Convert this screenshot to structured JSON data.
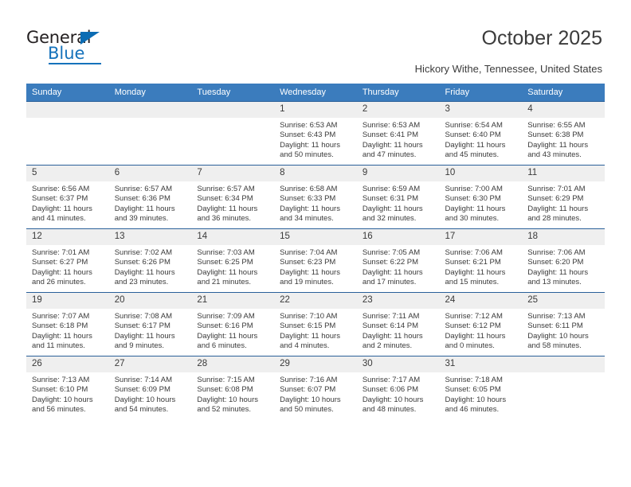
{
  "brand": {
    "name_top": "General",
    "name_bottom": "Blue",
    "accent_color": "#1572bb"
  },
  "header": {
    "title": "October 2025",
    "subtitle": "Hickory Withe, Tennessee, United States"
  },
  "calendar": {
    "header_bg": "#3b7cbd",
    "weekday_headers": [
      "Sunday",
      "Monday",
      "Tuesday",
      "Wednesday",
      "Thursday",
      "Friday",
      "Saturday"
    ],
    "labels": {
      "sunrise": "Sunrise:",
      "sunset": "Sunset:",
      "daylight": "Daylight:"
    },
    "weeks": [
      [
        {
          "day": "",
          "empty": true
        },
        {
          "day": "",
          "empty": true
        },
        {
          "day": "",
          "empty": true
        },
        {
          "day": "1",
          "sunrise": "Sunrise: 6:53 AM",
          "sunset": "Sunset: 6:43 PM",
          "daylight": "Daylight: 11 hours and 50 minutes."
        },
        {
          "day": "2",
          "sunrise": "Sunrise: 6:53 AM",
          "sunset": "Sunset: 6:41 PM",
          "daylight": "Daylight: 11 hours and 47 minutes."
        },
        {
          "day": "3",
          "sunrise": "Sunrise: 6:54 AM",
          "sunset": "Sunset: 6:40 PM",
          "daylight": "Daylight: 11 hours and 45 minutes."
        },
        {
          "day": "4",
          "sunrise": "Sunrise: 6:55 AM",
          "sunset": "Sunset: 6:38 PM",
          "daylight": "Daylight: 11 hours and 43 minutes."
        }
      ],
      [
        {
          "day": "5",
          "sunrise": "Sunrise: 6:56 AM",
          "sunset": "Sunset: 6:37 PM",
          "daylight": "Daylight: 11 hours and 41 minutes."
        },
        {
          "day": "6",
          "sunrise": "Sunrise: 6:57 AM",
          "sunset": "Sunset: 6:36 PM",
          "daylight": "Daylight: 11 hours and 39 minutes."
        },
        {
          "day": "7",
          "sunrise": "Sunrise: 6:57 AM",
          "sunset": "Sunset: 6:34 PM",
          "daylight": "Daylight: 11 hours and 36 minutes."
        },
        {
          "day": "8",
          "sunrise": "Sunrise: 6:58 AM",
          "sunset": "Sunset: 6:33 PM",
          "daylight": "Daylight: 11 hours and 34 minutes."
        },
        {
          "day": "9",
          "sunrise": "Sunrise: 6:59 AM",
          "sunset": "Sunset: 6:31 PM",
          "daylight": "Daylight: 11 hours and 32 minutes."
        },
        {
          "day": "10",
          "sunrise": "Sunrise: 7:00 AM",
          "sunset": "Sunset: 6:30 PM",
          "daylight": "Daylight: 11 hours and 30 minutes."
        },
        {
          "day": "11",
          "sunrise": "Sunrise: 7:01 AM",
          "sunset": "Sunset: 6:29 PM",
          "daylight": "Daylight: 11 hours and 28 minutes."
        }
      ],
      [
        {
          "day": "12",
          "sunrise": "Sunrise: 7:01 AM",
          "sunset": "Sunset: 6:27 PM",
          "daylight": "Daylight: 11 hours and 26 minutes."
        },
        {
          "day": "13",
          "sunrise": "Sunrise: 7:02 AM",
          "sunset": "Sunset: 6:26 PM",
          "daylight": "Daylight: 11 hours and 23 minutes."
        },
        {
          "day": "14",
          "sunrise": "Sunrise: 7:03 AM",
          "sunset": "Sunset: 6:25 PM",
          "daylight": "Daylight: 11 hours and 21 minutes."
        },
        {
          "day": "15",
          "sunrise": "Sunrise: 7:04 AM",
          "sunset": "Sunset: 6:23 PM",
          "daylight": "Daylight: 11 hours and 19 minutes."
        },
        {
          "day": "16",
          "sunrise": "Sunrise: 7:05 AM",
          "sunset": "Sunset: 6:22 PM",
          "daylight": "Daylight: 11 hours and 17 minutes."
        },
        {
          "day": "17",
          "sunrise": "Sunrise: 7:06 AM",
          "sunset": "Sunset: 6:21 PM",
          "daylight": "Daylight: 11 hours and 15 minutes."
        },
        {
          "day": "18",
          "sunrise": "Sunrise: 7:06 AM",
          "sunset": "Sunset: 6:20 PM",
          "daylight": "Daylight: 11 hours and 13 minutes."
        }
      ],
      [
        {
          "day": "19",
          "sunrise": "Sunrise: 7:07 AM",
          "sunset": "Sunset: 6:18 PM",
          "daylight": "Daylight: 11 hours and 11 minutes."
        },
        {
          "day": "20",
          "sunrise": "Sunrise: 7:08 AM",
          "sunset": "Sunset: 6:17 PM",
          "daylight": "Daylight: 11 hours and 9 minutes."
        },
        {
          "day": "21",
          "sunrise": "Sunrise: 7:09 AM",
          "sunset": "Sunset: 6:16 PM",
          "daylight": "Daylight: 11 hours and 6 minutes."
        },
        {
          "day": "22",
          "sunrise": "Sunrise: 7:10 AM",
          "sunset": "Sunset: 6:15 PM",
          "daylight": "Daylight: 11 hours and 4 minutes."
        },
        {
          "day": "23",
          "sunrise": "Sunrise: 7:11 AM",
          "sunset": "Sunset: 6:14 PM",
          "daylight": "Daylight: 11 hours and 2 minutes."
        },
        {
          "day": "24",
          "sunrise": "Sunrise: 7:12 AM",
          "sunset": "Sunset: 6:12 PM",
          "daylight": "Daylight: 11 hours and 0 minutes."
        },
        {
          "day": "25",
          "sunrise": "Sunrise: 7:13 AM",
          "sunset": "Sunset: 6:11 PM",
          "daylight": "Daylight: 10 hours and 58 minutes."
        }
      ],
      [
        {
          "day": "26",
          "sunrise": "Sunrise: 7:13 AM",
          "sunset": "Sunset: 6:10 PM",
          "daylight": "Daylight: 10 hours and 56 minutes."
        },
        {
          "day": "27",
          "sunrise": "Sunrise: 7:14 AM",
          "sunset": "Sunset: 6:09 PM",
          "daylight": "Daylight: 10 hours and 54 minutes."
        },
        {
          "day": "28",
          "sunrise": "Sunrise: 7:15 AM",
          "sunset": "Sunset: 6:08 PM",
          "daylight": "Daylight: 10 hours and 52 minutes."
        },
        {
          "day": "29",
          "sunrise": "Sunrise: 7:16 AM",
          "sunset": "Sunset: 6:07 PM",
          "daylight": "Daylight: 10 hours and 50 minutes."
        },
        {
          "day": "30",
          "sunrise": "Sunrise: 7:17 AM",
          "sunset": "Sunset: 6:06 PM",
          "daylight": "Daylight: 10 hours and 48 minutes."
        },
        {
          "day": "31",
          "sunrise": "Sunrise: 7:18 AM",
          "sunset": "Sunset: 6:05 PM",
          "daylight": "Daylight: 10 hours and 46 minutes."
        },
        {
          "day": "",
          "empty": true
        }
      ]
    ]
  }
}
